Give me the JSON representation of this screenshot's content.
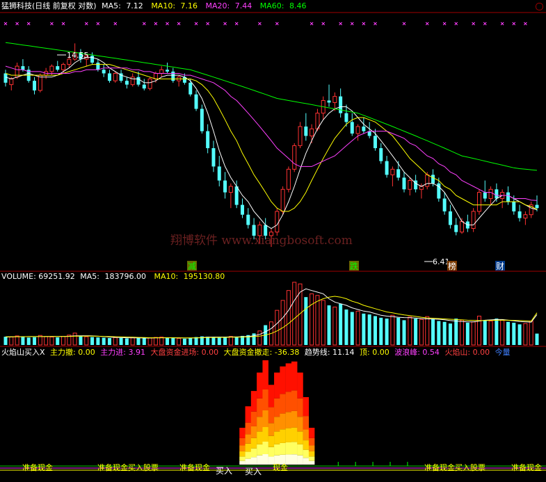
{
  "price_header": {
    "title": "猛狮科技(日线 前复权 对数)",
    "items": [
      {
        "label": "MA5:",
        "value": "7.12",
        "color": "#ffffff"
      },
      {
        "label": "MA10:",
        "value": "7.16",
        "color": "#ffff00"
      },
      {
        "label": "MA20:",
        "value": "7.44",
        "color": "#ff40ff"
      },
      {
        "label": "MA60:",
        "value": "8.46",
        "color": "#00ff00"
      }
    ]
  },
  "price_panel": {
    "high_label": "14.55",
    "low_label": "6.41",
    "watermark": "翔博软件 www.xiangbosoft.com",
    "tags": [
      {
        "text": "减",
        "color": "#00ff00",
        "bg": "#6a6a00"
      },
      {
        "text": "跌",
        "color": "#00ff00",
        "bg": "#6a6a00"
      },
      {
        "text": "榜",
        "color": "#ffffff",
        "bg": "#7a3a00"
      },
      {
        "text": "财",
        "color": "#ffffff",
        "bg": "#003a8a"
      }
    ]
  },
  "volume_header": {
    "title": "VOLUME: 69251.92",
    "items": [
      {
        "label": "MA5:",
        "value": "183796.00",
        "color": "#ffffff"
      },
      {
        "label": "MA10:",
        "value": "195130.80",
        "color": "#ffff00"
      }
    ]
  },
  "indicator_header": {
    "items": [
      {
        "text": "火焰山买入X",
        "color": "#ffffff"
      },
      {
        "text": "主力撤: 0.00",
        "color": "#ffff00"
      },
      {
        "text": "主力进: 3.91",
        "color": "#ff40ff"
      },
      {
        "text": "大盘资金进场: 0.00",
        "color": "#ff4040"
      },
      {
        "text": "大盘资金撤走: -36.38",
        "color": "#ffff00"
      },
      {
        "text": "趋势线: 11.14",
        "color": "#ffffff"
      },
      {
        "text": "顶: 0.00",
        "color": "#ffff00"
      },
      {
        "text": "波浪峰: 0.54",
        "color": "#ff40ff"
      },
      {
        "text": "火焰山: 0.00",
        "color": "#ff4040"
      },
      {
        "text": "今量",
        "color": "#4080ff"
      }
    ]
  },
  "indicator_panel": {
    "labels": [
      {
        "text": "准备现金",
        "color": "#ffff00"
      },
      {
        "text": "准备现金买入股票",
        "color": "#ffff00"
      },
      {
        "text": "准备现金",
        "color": "#ffff00"
      },
      {
        "text": "买入",
        "color": "#ffffff"
      },
      {
        "text": "买入",
        "color": "#ffffff"
      },
      {
        "text": "现金",
        "color": "#ffff00"
      },
      {
        "text": "准备现金买入股票",
        "color": "#ffff00"
      },
      {
        "text": "准备现金",
        "color": "#ffff00"
      }
    ]
  },
  "colors": {
    "up": "#ff3232",
    "down": "#54ffff",
    "ma5": "#ffffff",
    "ma10": "#ffff00",
    "ma20": "#ff40ff",
    "ma60": "#00ff00",
    "axis": "#a00000",
    "marker": "#ff40ff"
  },
  "chart_data": {
    "type": "candlestick",
    "y_scale": "log",
    "ylim": [
      5.8,
      16.5
    ],
    "ohlc": [
      [
        12.8,
        13.0,
        12.1,
        12.3
      ],
      [
        12.2,
        12.6,
        11.9,
        12.5
      ],
      [
        12.6,
        13.4,
        12.5,
        13.2
      ],
      [
        13.2,
        13.6,
        12.9,
        13.0
      ],
      [
        13.0,
        13.2,
        12.3,
        12.4
      ],
      [
        12.4,
        12.6,
        11.7,
        11.9
      ],
      [
        11.9,
        12.8,
        11.8,
        12.7
      ],
      [
        12.7,
        13.1,
        12.5,
        12.9
      ],
      [
        12.9,
        13.3,
        12.7,
        13.2
      ],
      [
        13.2,
        13.5,
        12.9,
        13.0
      ],
      [
        13.0,
        13.4,
        12.8,
        13.3
      ],
      [
        13.3,
        13.8,
        13.1,
        13.6
      ],
      [
        13.6,
        14.55,
        13.5,
        14.0
      ],
      [
        14.0,
        14.2,
        13.4,
        13.6
      ],
      [
        13.6,
        13.9,
        13.2,
        13.8
      ],
      [
        13.8,
        14.0,
        13.3,
        13.4
      ],
      [
        13.4,
        13.6,
        12.9,
        13.0
      ],
      [
        13.0,
        13.3,
        12.6,
        12.8
      ],
      [
        12.8,
        13.0,
        12.3,
        12.4
      ],
      [
        12.4,
        12.9,
        12.3,
        12.8
      ],
      [
        12.8,
        13.0,
        12.3,
        12.4
      ],
      [
        12.4,
        12.6,
        12.0,
        12.2
      ],
      [
        12.2,
        12.8,
        12.1,
        12.6
      ],
      [
        12.6,
        12.9,
        12.1,
        12.2
      ],
      [
        12.2,
        12.5,
        11.9,
        12.0
      ],
      [
        12.0,
        12.6,
        11.9,
        12.5
      ],
      [
        12.5,
        12.9,
        12.3,
        12.8
      ],
      [
        12.8,
        13.2,
        12.6,
        13.0
      ],
      [
        13.0,
        13.4,
        12.8,
        12.9
      ],
      [
        12.9,
        13.1,
        12.3,
        12.4
      ],
      [
        12.4,
        12.7,
        12.1,
        12.6
      ],
      [
        12.6,
        12.8,
        12.2,
        12.3
      ],
      [
        12.3,
        12.5,
        11.6,
        11.7
      ],
      [
        11.7,
        11.9,
        10.9,
        11.0
      ],
      [
        11.0,
        11.2,
        9.9,
        10.0
      ],
      [
        10.0,
        10.3,
        9.1,
        9.3
      ],
      [
        9.3,
        9.6,
        8.4,
        8.6
      ],
      [
        8.6,
        9.0,
        7.9,
        8.1
      ],
      [
        8.1,
        8.4,
        7.5,
        7.7
      ],
      [
        7.7,
        8.0,
        7.2,
        7.9
      ],
      [
        7.9,
        8.1,
        7.2,
        7.3
      ],
      [
        7.3,
        7.5,
        6.9,
        7.0
      ],
      [
        7.0,
        7.2,
        6.6,
        6.7
      ],
      [
        6.7,
        6.9,
        6.3,
        6.4
      ],
      [
        6.4,
        6.8,
        6.2,
        6.7
      ],
      [
        6.7,
        6.9,
        6.3,
        6.4
      ],
      [
        6.4,
        6.6,
        6.1,
        6.5
      ],
      [
        6.5,
        7.2,
        6.4,
        7.1
      ],
      [
        7.1,
        7.9,
        7.0,
        7.8
      ],
      [
        7.8,
        8.6,
        7.7,
        8.5
      ],
      [
        8.5,
        9.5,
        8.4,
        9.4
      ],
      [
        9.4,
        10.4,
        9.3,
        10.2
      ],
      [
        10.2,
        10.8,
        9.6,
        9.8
      ],
      [
        9.8,
        10.3,
        9.5,
        10.1
      ],
      [
        10.1,
        11.0,
        10.0,
        10.8
      ],
      [
        10.8,
        11.6,
        10.5,
        11.4
      ],
      [
        11.4,
        12.2,
        11.1,
        11.3
      ],
      [
        11.3,
        11.8,
        10.9,
        11.6
      ],
      [
        11.6,
        12.0,
        10.6,
        10.8
      ],
      [
        10.8,
        11.2,
        10.2,
        10.4
      ],
      [
        10.4,
        10.8,
        9.8,
        9.9
      ],
      [
        9.9,
        10.3,
        9.6,
        10.2
      ],
      [
        10.2,
        10.6,
        9.9,
        10.0
      ],
      [
        10.0,
        10.4,
        9.7,
        9.8
      ],
      [
        9.8,
        10.1,
        9.2,
        9.3
      ],
      [
        9.3,
        9.5,
        8.7,
        8.8
      ],
      [
        8.8,
        9.0,
        8.2,
        8.3
      ],
      [
        8.3,
        8.6,
        7.9,
        8.5
      ],
      [
        8.5,
        8.8,
        8.1,
        8.2
      ],
      [
        8.2,
        8.4,
        7.7,
        7.8
      ],
      [
        7.8,
        8.2,
        7.6,
        8.1
      ],
      [
        8.1,
        8.3,
        7.7,
        7.8
      ],
      [
        7.8,
        8.0,
        7.5,
        7.9
      ],
      [
        7.9,
        8.4,
        7.8,
        8.3
      ],
      [
        8.3,
        8.5,
        7.9,
        8.0
      ],
      [
        8.0,
        8.2,
        7.4,
        7.5
      ],
      [
        7.5,
        7.7,
        7.0,
        7.1
      ],
      [
        7.1,
        7.3,
        6.6,
        6.7
      ],
      [
        6.7,
        6.9,
        6.41,
        6.5
      ],
      [
        6.5,
        6.9,
        6.45,
        6.8
      ],
      [
        6.8,
        7.0,
        6.5,
        6.6
      ],
      [
        6.6,
        7.2,
        6.5,
        7.1
      ],
      [
        7.1,
        7.8,
        7.0,
        7.7
      ],
      [
        7.7,
        8.1,
        7.4,
        7.5
      ],
      [
        7.5,
        7.9,
        7.3,
        7.8
      ],
      [
        7.8,
        8.0,
        7.4,
        7.5
      ],
      [
        7.5,
        7.8,
        7.2,
        7.7
      ],
      [
        7.7,
        7.9,
        7.3,
        7.4
      ],
      [
        7.4,
        7.6,
        7.0,
        7.1
      ],
      [
        7.1,
        7.3,
        6.8,
        6.9
      ],
      [
        6.9,
        7.1,
        6.7,
        7.0
      ],
      [
        7.0,
        7.4,
        6.9,
        7.3
      ],
      [
        7.3,
        7.6,
        7.1,
        7.2
      ]
    ],
    "ma": {
      "ma5": [
        12.6,
        12.5,
        12.6,
        12.7,
        12.8,
        12.7,
        12.6,
        12.6,
        12.6,
        12.7,
        12.9,
        13.1,
        13.4,
        13.6,
        13.7,
        13.7,
        13.6,
        13.4,
        13.1,
        12.9,
        12.7,
        12.6,
        12.5,
        12.5,
        12.3,
        12.3,
        12.4,
        12.6,
        12.7,
        12.7,
        12.7,
        12.6,
        12.4,
        12.0,
        11.5,
        10.8,
        10.0,
        9.2,
        8.6,
        8.2,
        7.9,
        7.6,
        7.4,
        7.1,
        6.9,
        6.7,
        6.6,
        6.7,
        7.0,
        7.4,
        7.9,
        8.5,
        9.1,
        9.6,
        10.1,
        10.5,
        10.8,
        11.0,
        11.1,
        11.1,
        10.9,
        10.6,
        10.3,
        10.1,
        9.9,
        9.6,
        9.3,
        9.0,
        8.7,
        8.4,
        8.2,
        8.0,
        7.9,
        8.0,
        8.0,
        7.9,
        7.7,
        7.4,
        7.1,
        6.8,
        6.7,
        6.7,
        6.9,
        7.1,
        7.3,
        7.5,
        7.6,
        7.6,
        7.5,
        7.4,
        7.3,
        7.2,
        7.15
      ],
      "ma10": [
        12.8,
        12.7,
        12.7,
        12.7,
        12.7,
        12.7,
        12.7,
        12.7,
        12.7,
        12.7,
        12.8,
        12.9,
        13.0,
        13.1,
        13.2,
        13.3,
        13.3,
        13.3,
        13.3,
        13.2,
        13.1,
        13.0,
        12.9,
        12.8,
        12.7,
        12.6,
        12.5,
        12.5,
        12.5,
        12.5,
        12.5,
        12.5,
        12.5,
        12.4,
        12.2,
        11.9,
        11.5,
        11.0,
        10.5,
        10.0,
        9.6,
        9.1,
        8.7,
        8.3,
        8.0,
        7.7,
        7.4,
        7.2,
        7.1,
        7.1,
        7.2,
        7.4,
        7.7,
        8.1,
        8.5,
        8.9,
        9.3,
        9.7,
        10.0,
        10.3,
        10.5,
        10.6,
        10.6,
        10.5,
        10.4,
        10.2,
        10.0,
        9.8,
        9.5,
        9.2,
        8.9,
        8.7,
        8.5,
        8.3,
        8.2,
        8.1,
        7.9,
        7.8,
        7.6,
        7.5,
        7.4,
        7.3,
        7.3,
        7.3,
        7.3,
        7.3,
        7.4,
        7.4,
        7.4,
        7.4,
        7.3,
        7.25,
        7.16
      ],
      "ma20": [
        13.2,
        13.1,
        13.0,
        13.0,
        12.9,
        12.9,
        12.9,
        12.8,
        12.8,
        12.8,
        12.8,
        12.8,
        12.9,
        12.9,
        13.0,
        13.0,
        13.0,
        13.1,
        13.1,
        13.1,
        13.1,
        13.1,
        13.0,
        13.0,
        12.9,
        12.9,
        12.8,
        12.8,
        12.8,
        12.8,
        12.8,
        12.7,
        12.7,
        12.6,
        12.5,
        12.4,
        12.3,
        12.1,
        11.9,
        11.6,
        11.4,
        11.1,
        10.8,
        10.5,
        10.2,
        9.9,
        9.6,
        9.3,
        9.1,
        8.9,
        8.7,
        8.6,
        8.6,
        8.6,
        8.7,
        8.8,
        8.9,
        9.0,
        9.2,
        9.4,
        9.6,
        9.8,
        9.9,
        10.0,
        10.0,
        10.0,
        10.0,
        9.9,
        9.8,
        9.7,
        9.5,
        9.4,
        9.2,
        9.0,
        8.9,
        8.7,
        8.6,
        8.4,
        8.3,
        8.1,
        8.0,
        7.9,
        7.8,
        7.7,
        7.7,
        7.6,
        7.6,
        7.6,
        7.5,
        7.5,
        7.5,
        7.45,
        7.44
      ],
      "ma60": [
        14.6,
        14.55,
        14.5,
        14.45,
        14.4,
        14.35,
        14.3,
        14.25,
        14.2,
        14.15,
        14.1,
        14.05,
        14.0,
        13.95,
        13.9,
        13.85,
        13.8,
        13.75,
        13.7,
        13.65,
        13.6,
        13.55,
        13.5,
        13.45,
        13.4,
        13.35,
        13.3,
        13.25,
        13.2,
        13.15,
        13.1,
        13.05,
        13.0,
        12.9,
        12.8,
        12.7,
        12.6,
        12.5,
        12.4,
        12.3,
        12.2,
        12.1,
        12.0,
        11.9,
        11.8,
        11.7,
        11.6,
        11.5,
        11.45,
        11.4,
        11.35,
        11.3,
        11.25,
        11.2,
        11.15,
        11.1,
        11.05,
        11.0,
        10.95,
        10.9,
        10.85,
        10.8,
        10.7,
        10.6,
        10.5,
        10.4,
        10.3,
        10.2,
        10.1,
        10.0,
        9.9,
        9.8,
        9.7,
        9.6,
        9.5,
        9.4,
        9.3,
        9.2,
        9.1,
        9.0,
        8.95,
        8.9,
        8.85,
        8.8,
        8.75,
        8.7,
        8.65,
        8.6,
        8.55,
        8.52,
        8.5,
        8.48,
        8.46
      ]
    },
    "volume": [
      50,
      48,
      55,
      52,
      45,
      47,
      58,
      50,
      48,
      46,
      52,
      60,
      72,
      55,
      50,
      48,
      46,
      44,
      42,
      45,
      43,
      40,
      44,
      42,
      40,
      43,
      46,
      48,
      45,
      42,
      40,
      38,
      42,
      48,
      52,
      50,
      46,
      44,
      48,
      52,
      50,
      55,
      60,
      70,
      85,
      120,
      140,
      210,
      270,
      330,
      380,
      370,
      290,
      310,
      300,
      270,
      240,
      230,
      250,
      215,
      200,
      205,
      190,
      185,
      175,
      165,
      160,
      180,
      165,
      150,
      170,
      160,
      155,
      172,
      158,
      145,
      140,
      130,
      160,
      150,
      135,
      140,
      175,
      150,
      145,
      160,
      150,
      140,
      135,
      125,
      130,
      145,
      69
    ],
    "volume_ma5": [
      48,
      49,
      50,
      50,
      51,
      51,
      51,
      52,
      52,
      52,
      52,
      53,
      55,
      56,
      56,
      55,
      53,
      51,
      48,
      46,
      45,
      44,
      43,
      43,
      42,
      42,
      43,
      44,
      44,
      44,
      43,
      42,
      42,
      43,
      45,
      47,
      48,
      48,
      48,
      49,
      49,
      50,
      52,
      56,
      64,
      80,
      100,
      130,
      165,
      210,
      270,
      320,
      340,
      330,
      320,
      310,
      280,
      260,
      250,
      240,
      225,
      215,
      205,
      200,
      190,
      180,
      175,
      172,
      168,
      166,
      165,
      163,
      160,
      158,
      157,
      156,
      153,
      148,
      145,
      142,
      140,
      140,
      145,
      150,
      152,
      154,
      154,
      150,
      146,
      142,
      140,
      138,
      184
    ],
    "volume_ma10": [
      50,
      50,
      50,
      50,
      51,
      51,
      51,
      51,
      52,
      52,
      52,
      52,
      53,
      53,
      54,
      54,
      53,
      52,
      51,
      50,
      49,
      48,
      47,
      46,
      45,
      44,
      44,
      44,
      44,
      44,
      43,
      43,
      43,
      43,
      44,
      45,
      45,
      46,
      46,
      47,
      47,
      48,
      49,
      51,
      54,
      60,
      70,
      85,
      105,
      130,
      160,
      190,
      220,
      245,
      265,
      280,
      290,
      295,
      290,
      280,
      265,
      255,
      240,
      230,
      220,
      210,
      200,
      195,
      188,
      182,
      178,
      173,
      168,
      164,
      162,
      160,
      158,
      156,
      154,
      152,
      150,
      149,
      148,
      148,
      149,
      150,
      151,
      150,
      149,
      148,
      146,
      144,
      195
    ]
  }
}
